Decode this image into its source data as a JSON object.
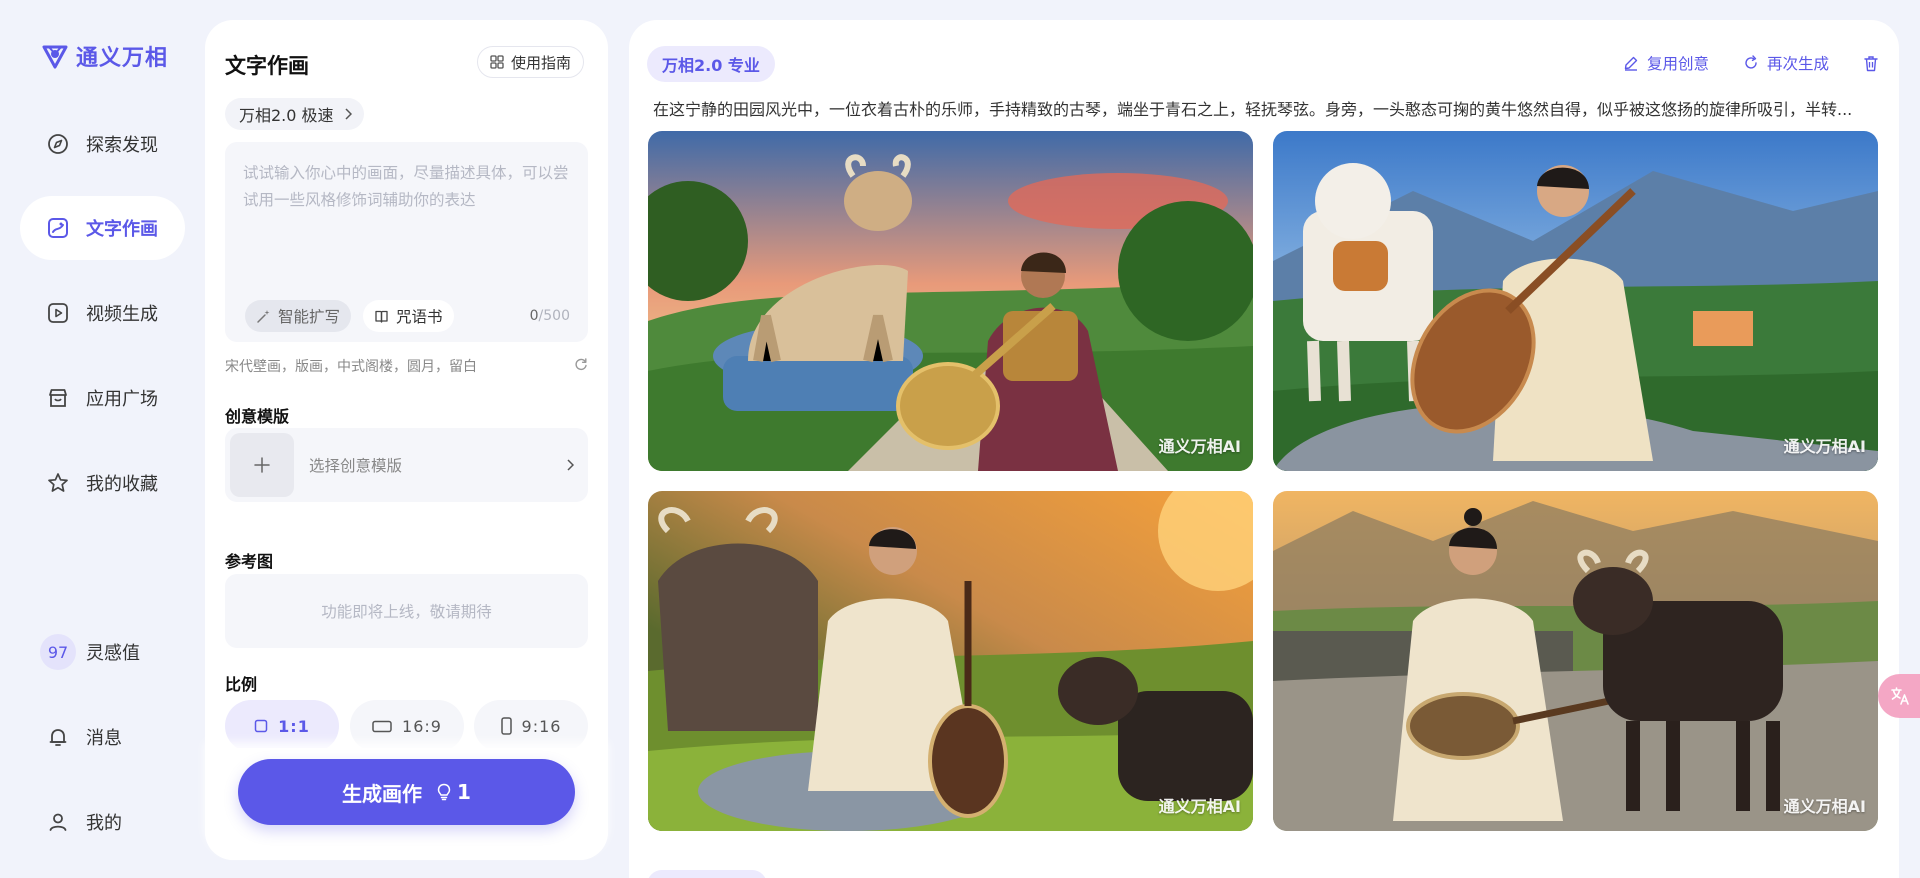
{
  "brand": {
    "name": "通义万相"
  },
  "nav": {
    "items": [
      {
        "label": "探索发现",
        "icon": "compass-icon"
      },
      {
        "label": "文字作画",
        "icon": "picture-icon",
        "active": true
      },
      {
        "label": "视频生成",
        "icon": "play-icon"
      },
      {
        "label": "应用广场",
        "icon": "store-icon"
      },
      {
        "label": "我的收藏",
        "icon": "star-icon"
      }
    ],
    "bottom": {
      "inspiration_count": "97",
      "inspiration_label": "灵感值",
      "messages_label": "消息",
      "me_label": "我的"
    }
  },
  "form": {
    "title": "文字作画",
    "guide_label": "使用指南",
    "model_label": "万相2.0 极速",
    "prompt": {
      "value": "",
      "placeholder": "试试输入你心中的画面，尽量描述具体，可以尝试用一些风格修饰词辅助你的表达"
    },
    "smart_expand_label": "智能扩写",
    "spellbook_label": "咒语书",
    "counter_current": "0",
    "counter_max": "/500",
    "style_hints": "宋代壁画，版画，中式阁楼，圆月，留白",
    "template_section": "创意模版",
    "template_placeholder": "选择创意模版",
    "reference_section": "参考图",
    "reference_placeholder": "功能即将上线，敬请期待",
    "ratio_section": "比例",
    "ratios": [
      {
        "label": "1:1",
        "active": true
      },
      {
        "label": "16:9",
        "active": false
      },
      {
        "label": "9:16",
        "active": false
      }
    ],
    "generate_label": "生成画作",
    "generate_cost": "1"
  },
  "results": {
    "model_tag": "万相2.0 专业",
    "actions": {
      "reuse": "复用创意",
      "regenerate": "再次生成"
    },
    "prompt_text": "在这宁静的田园风光中，一位衣着古朴的乐师，手持精致的古琴，端坐于青石之上，轻抚琴弦。身旁，一头憨态可掬的黄牛悠然自得，似乎被这悠扬的旋律所吸引，半转...",
    "watermark": "通义万相AI",
    "images": [
      {
        "alt": "bard with lute beside a cow on stone pedestal at sunset"
      },
      {
        "alt": "man in robe playing pipa beside a cow on a meadow"
      },
      {
        "alt": "man in robe with pipa between two cows at sunset"
      },
      {
        "alt": "man in robe with pipa touching a dark cow on stone plaza"
      }
    ]
  },
  "colors": {
    "accent": "#5b58e8",
    "accent_soft": "#eceafd",
    "page_bg": "#f1f3fb"
  }
}
